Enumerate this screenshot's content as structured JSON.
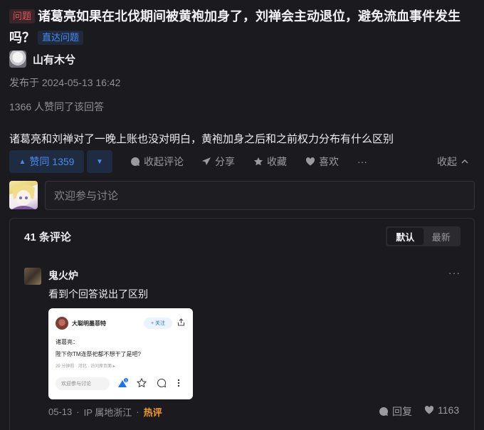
{
  "question": {
    "tag": "问题",
    "title": "诸葛亮如果在北伐期间被黄袍加身了，刘禅会主动退位，避免流血事件发生吗？",
    "link_label": "直达问题"
  },
  "author": {
    "name": "山有木兮"
  },
  "answer": {
    "published": "发布于 2024-05-13 16:42",
    "likes_line": "1366 人赞同了该回答",
    "text": "诸葛亮和刘禅对了一晚上账也没对明白，黄袍加身之后和之前权力分布有什么区别"
  },
  "actions": {
    "upvote_label": "赞同 1359",
    "comment_label": "收起评论",
    "share_label": "分享",
    "favorite_label": "收藏",
    "like_label": "喜欢",
    "more_label": "···",
    "collapse_label": "收起"
  },
  "comment_input": {
    "placeholder": "欢迎参与讨论"
  },
  "comments": {
    "count_label": "41 条评论",
    "sort_default": "默认",
    "sort_latest": "最新",
    "item": {
      "name": "鬼火炉",
      "text": "看到个回答说出了区别",
      "date": "05-13",
      "sep1": "·",
      "ip": "IP 属地浙江",
      "sep2": "·",
      "hot": "热评",
      "reply_label": "回复",
      "like_count": "1163",
      "more": "···"
    },
    "embed": {
      "name": "大聪明墨菲特",
      "follow": "+ 关注",
      "line1": "诸葛亮：",
      "line2": "陛下你TM连祭祀都不想干了是吧?",
      "meta": "29 分钟前 · 河北 · 访问原页面 ▸",
      "input": "欢迎参与讨论",
      "badge": "1"
    }
  },
  "colors": {
    "background": "#1b1b1f",
    "accent_blue": "#4a8bf0",
    "tag_red": "#e2585b",
    "hot_orange": "#f29a2b"
  }
}
